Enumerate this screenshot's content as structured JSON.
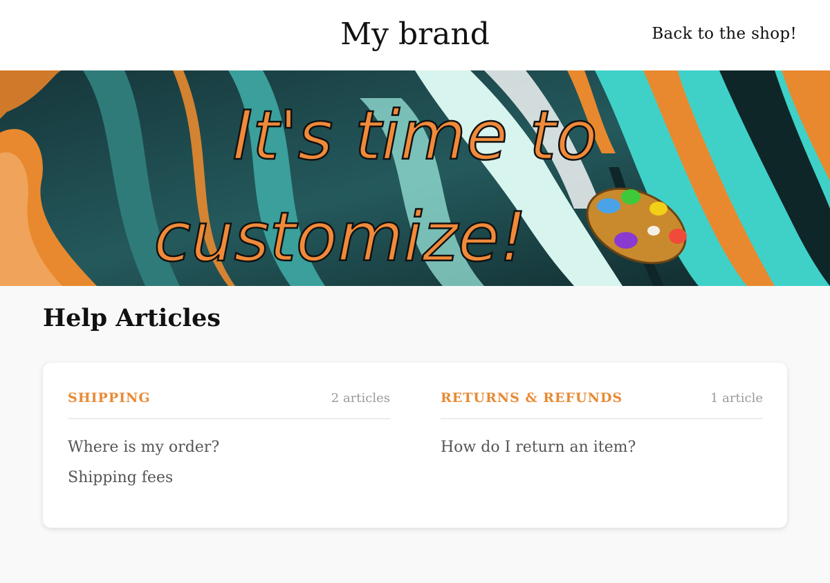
{
  "header": {
    "brand": "My brand",
    "back_link": "Back to the shop!"
  },
  "banner": {
    "line1": "It's time to",
    "line2": "customize!",
    "colors": {
      "text_fill": "#f08a3a",
      "text_stroke": "#111111",
      "teal": "#3fd1c8",
      "dark": "#1d3d40",
      "orange": "#e8892f"
    },
    "palette_icon": "paint-palette-icon"
  },
  "help": {
    "title": "Help Articles",
    "categories": [
      {
        "name": "SHIPPING",
        "count": "2 articles",
        "articles": [
          "Where is my order?",
          "Shipping fees"
        ]
      },
      {
        "name": "RETURNS & REFUNDS",
        "count": "1 article",
        "articles": [
          "How do I return an item?"
        ]
      }
    ]
  },
  "colors": {
    "accent": "#e88a35",
    "muted": "#999999",
    "text": "#555555"
  }
}
